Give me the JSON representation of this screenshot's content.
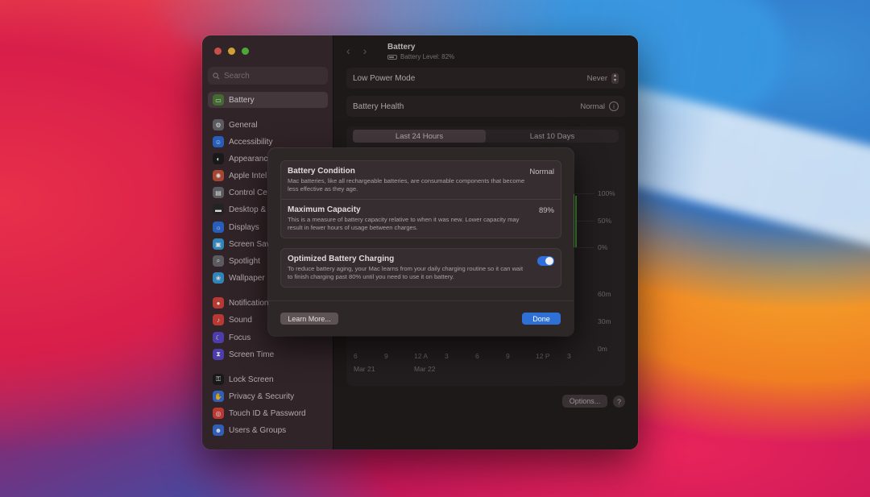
{
  "sidebar": {
    "search_placeholder": "Search",
    "items": [
      {
        "label": "Battery",
        "icon": "battery-icon",
        "color": "#4e7d3a"
      },
      {
        "label": "General",
        "icon": "gear-icon",
        "color": "#6c6c70"
      },
      {
        "label": "Accessibility",
        "icon": "accessibility-icon",
        "color": "#2f6fdc"
      },
      {
        "label": "Appearance",
        "icon": "appearance-icon",
        "color": "#1e1e1e"
      },
      {
        "label": "Apple Intel",
        "icon": "apple-intelligence-icon",
        "color": "#c2533b"
      },
      {
        "label": "Control Ce",
        "icon": "control-center-icon",
        "color": "#6c6c70"
      },
      {
        "label": "Desktop &",
        "icon": "desktop-dock-icon",
        "color": "#2a2a2a"
      },
      {
        "label": "Displays",
        "icon": "displays-icon",
        "color": "#2f6fdc"
      },
      {
        "label": "Screen Sav",
        "icon": "screen-saver-icon",
        "color": "#3b9ad8"
      },
      {
        "label": "Spotlight",
        "icon": "spotlight-icon",
        "color": "#6c6c70"
      },
      {
        "label": "Wallpaper",
        "icon": "wallpaper-icon",
        "color": "#3b9ad8"
      },
      {
        "label": "Notification",
        "icon": "notifications-icon",
        "color": "#d9443c"
      },
      {
        "label": "Sound",
        "icon": "sound-icon",
        "color": "#d9443c"
      },
      {
        "label": "Focus",
        "icon": "focus-icon",
        "color": "#5a48c8"
      },
      {
        "label": "Screen Time",
        "icon": "screen-time-icon",
        "color": "#5a48c8"
      },
      {
        "label": "Lock Screen",
        "icon": "lock-icon",
        "color": "#1e1e1e"
      },
      {
        "label": "Privacy & Security",
        "icon": "privacy-hand-icon",
        "color": "#3a6fd8"
      },
      {
        "label": "Touch ID & Password",
        "icon": "fingerprint-icon",
        "color": "#d9443c"
      },
      {
        "label": "Users & Groups",
        "icon": "users-icon",
        "color": "#3a6fd8"
      }
    ]
  },
  "header": {
    "title": "Battery",
    "subtitle": "Battery Level: 82%",
    "back_glyph": "‹",
    "forward_glyph": "›"
  },
  "rows": {
    "low_power_label": "Low Power Mode",
    "low_power_value": "Never",
    "health_label": "Battery Health",
    "health_value": "Normal"
  },
  "chart": {
    "tabs": [
      "Last 24 Hours",
      "Last 10 Days"
    ],
    "right_labels_top": [
      "100%",
      "50%",
      "0%"
    ],
    "right_labels_bottom": [
      "60m",
      "30m",
      "0m"
    ],
    "x_ticks": [
      "6",
      "9",
      "12 A",
      "3",
      "6",
      "9",
      "12 P",
      "3"
    ],
    "dates": [
      "Mar 21",
      "Mar 22"
    ]
  },
  "chart_data": {
    "type": "bar",
    "title": "",
    "series": [
      {
        "name": "",
        "values": [
          100,
          98,
          96
        ]
      }
    ],
    "ylim": [
      0,
      100
    ],
    "ylabel": "",
    "xlabel": ""
  },
  "footer": {
    "options_label": "Options...",
    "help_label": "?"
  },
  "sheet": {
    "condition_title": "Battery Condition",
    "condition_value": "Normal",
    "condition_desc": "Mac batteries, like all rechargeable batteries, are consumable components that become less effective as they age.",
    "capacity_title": "Maximum Capacity",
    "capacity_value": "89%",
    "capacity_desc": "This is a measure of battery capacity relative to when it was new. Lower capacity may result in fewer hours of usage between charges.",
    "optimized_title": "Optimized Battery Charging",
    "optimized_desc": "To reduce battery aging, your Mac learns from your daily charging routine so it can wait to finish charging past 80% until you need to use it on battery.",
    "optimized_on": true,
    "learn_more_label": "Learn More...",
    "done_label": "Done"
  },
  "colors": {
    "accent": "#2e70d6",
    "battery_green": "#4ea043"
  }
}
